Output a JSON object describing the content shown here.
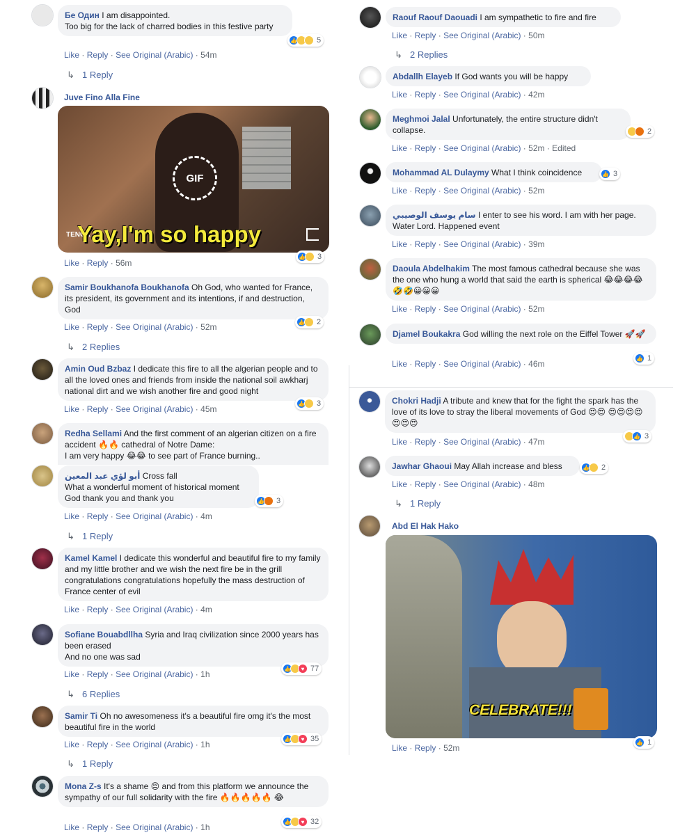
{
  "meta_labels": {
    "like": "Like",
    "reply": "Reply",
    "see_original": "See Original (Arabic)",
    "edited": "Edited",
    "sep": "·"
  },
  "left": [
    {
      "author": "Бе Один",
      "text": "I am disappointed.\nToo big for the lack of charred bodies in this festive party",
      "reactions": [
        "like",
        "haha",
        "sad"
      ],
      "count": "5",
      "time": "54m",
      "original": true,
      "replies": "1 Reply"
    },
    {
      "author": "Juve Fino Alla Fine",
      "gif": {
        "caption": "Yay,I'm so happy",
        "badge": "GIF",
        "brand": "TENOR"
      },
      "reactions": [
        "like",
        "sad"
      ],
      "count": "3",
      "time": "56m",
      "original": false
    },
    {
      "author": "Samir Boukhanofa Boukhanofa",
      "text": "Oh God, who wanted for France, its president, its government and its intentions, if and destruction, God",
      "reactions": [
        "like",
        "haha"
      ],
      "count": "2",
      "time": "52m",
      "original": true,
      "replies": "2 Replies"
    },
    {
      "author": "Amin Oud Bzbaz",
      "text": "I dedicate this fire to all the algerian people and to all the loved ones and friends from inside the national soil awkharj national dirt and we wish another fire and good night",
      "reactions": [
        "like",
        "haha"
      ],
      "count": "3",
      "time": "45m",
      "original": true
    },
    {
      "author": "Redha Sellami",
      "text": "And the first comment of an algerian citizen on a fire accident 🔥🔥 cathedral of Notre Dame:\nI am very happy 😂😂 to see part of France burning..",
      "time": "",
      "original": false
    },
    {
      "author": "أبو لؤي عبد المعين",
      "text": "Cross fall\nWhat a wonderful moment of historical moment\nGod thank you and thank you",
      "reactions": [
        "like",
        "angry"
      ],
      "count": "3",
      "time": "4m",
      "original": true,
      "replies": "1 Reply"
    },
    {
      "author": "Kamel Kamel",
      "text": "I dedicate this wonderful and beautiful fire to my family and my little brother and we wish the next fire be in the grill congratulations congratulations hopefully the mass destruction of France center of evil",
      "time": "4m",
      "original": true
    },
    {
      "author": "Sofiane Bouabdllha",
      "text": "Syria and Iraq civilization since 2000 years has been erased\nAnd no one was sad",
      "reactions": [
        "like",
        "sad",
        "love"
      ],
      "count": "77",
      "time": "1h",
      "original": true,
      "replies": "6 Replies"
    },
    {
      "author": "Samir Ti",
      "text": "Oh no awesomeness it's a beautiful fire omg it's the most beautiful fire in the world",
      "reactions": [
        "like",
        "haha",
        "love"
      ],
      "count": "35",
      "time": "1h",
      "original": true,
      "replies": "1 Reply"
    },
    {
      "author": "Mona Z-s",
      "text": "It's a shame 😔 and from this platform we announce the sympathy of our full solidarity with the fire 🔥🔥🔥🔥🔥 😂",
      "reactions": [
        "like",
        "haha",
        "love"
      ],
      "count": "32",
      "time": "1h",
      "original": true
    }
  ],
  "right": [
    {
      "author": "Raouf Raouf Daouadi",
      "text": "I am sympathetic to fire and fire",
      "time": "50m",
      "original": true,
      "replies": "2 Replies"
    },
    {
      "author": "Abdallh Elayeb",
      "text": "If God wants you will be happy",
      "time": "42m",
      "original": true
    },
    {
      "author": "Meghmoi Jalal",
      "text": "Unfortunately, the entire structure didn't collapse.",
      "reactions": [
        "haha",
        "angry"
      ],
      "count": "2",
      "time": "52m",
      "original": true,
      "edited": true
    },
    {
      "author": "Mohammad AL Dulaymy",
      "text": "What I think coincidence",
      "reactions": [
        "like"
      ],
      "count": "3",
      "time": "52m",
      "original": true
    },
    {
      "author": "سام يوسف الوصيبي",
      "text": "I enter to see his word. I am with her page. Water Lord. Happened event",
      "time": "39m",
      "original": true
    },
    {
      "author": "Daoula Abdelhakim",
      "text": "The most famous cathedral because she was the one who hung a world that said the earth is spherical 😂😂😂😂🤣🤣😀😀😀",
      "time": "52m",
      "original": true
    },
    {
      "author": "Djamel Boukakra",
      "text": "God willing the next role on the Eiffel Tower 🚀🚀",
      "reactions": [
        "like"
      ],
      "count": "1",
      "time": "46m",
      "original": true
    },
    {
      "author": "Chokri Hadji",
      "text": "A tribute and knew that for the fight the spark has the love of its love to stray the liberal movements of God 😍😍 😍😍😍😍😍😍😍",
      "reactions": [
        "haha",
        "like"
      ],
      "count": "3",
      "time": "47m",
      "original": true
    },
    {
      "author": "Jawhar Ghaoui",
      "text": "May Allah increase and bless",
      "reactions": [
        "like",
        "haha"
      ],
      "count": "2",
      "time": "48m",
      "original": true,
      "replies": "1 Reply"
    },
    {
      "author": "Abd El Hak Hako",
      "gif": {
        "caption": "CELEBRATE!!!"
      },
      "reactions": [
        "like"
      ],
      "count": "1",
      "time": "52m",
      "original": false
    }
  ]
}
